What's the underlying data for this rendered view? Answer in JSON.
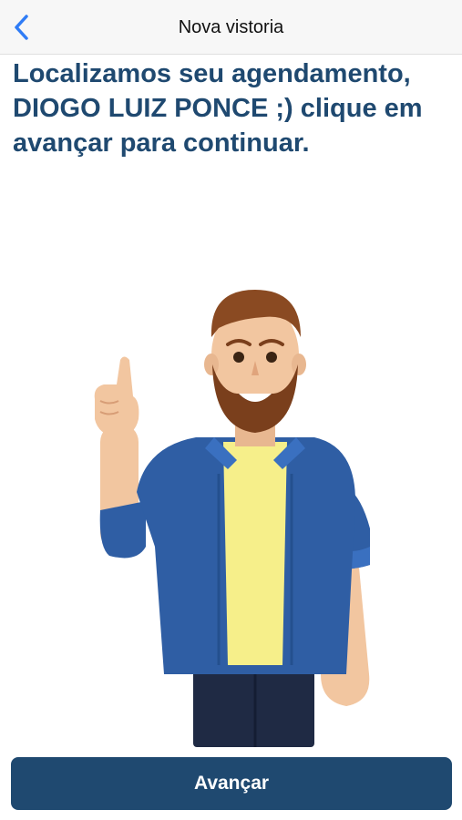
{
  "header": {
    "title": "Nova vistoria",
    "back_icon": "chevron-left-icon"
  },
  "main": {
    "message": "Localizamos seu agendamento, DIOGO LUIZ PONCE ;) clique em avançar para continuar.",
    "illustration": "bearded-man-pointing-up-illustration"
  },
  "footer": {
    "primary_button_label": "Avançar"
  },
  "colors": {
    "accent": "#1f4970",
    "back_icon": "#2f7cf6",
    "nav_background": "#f7f7f7"
  }
}
